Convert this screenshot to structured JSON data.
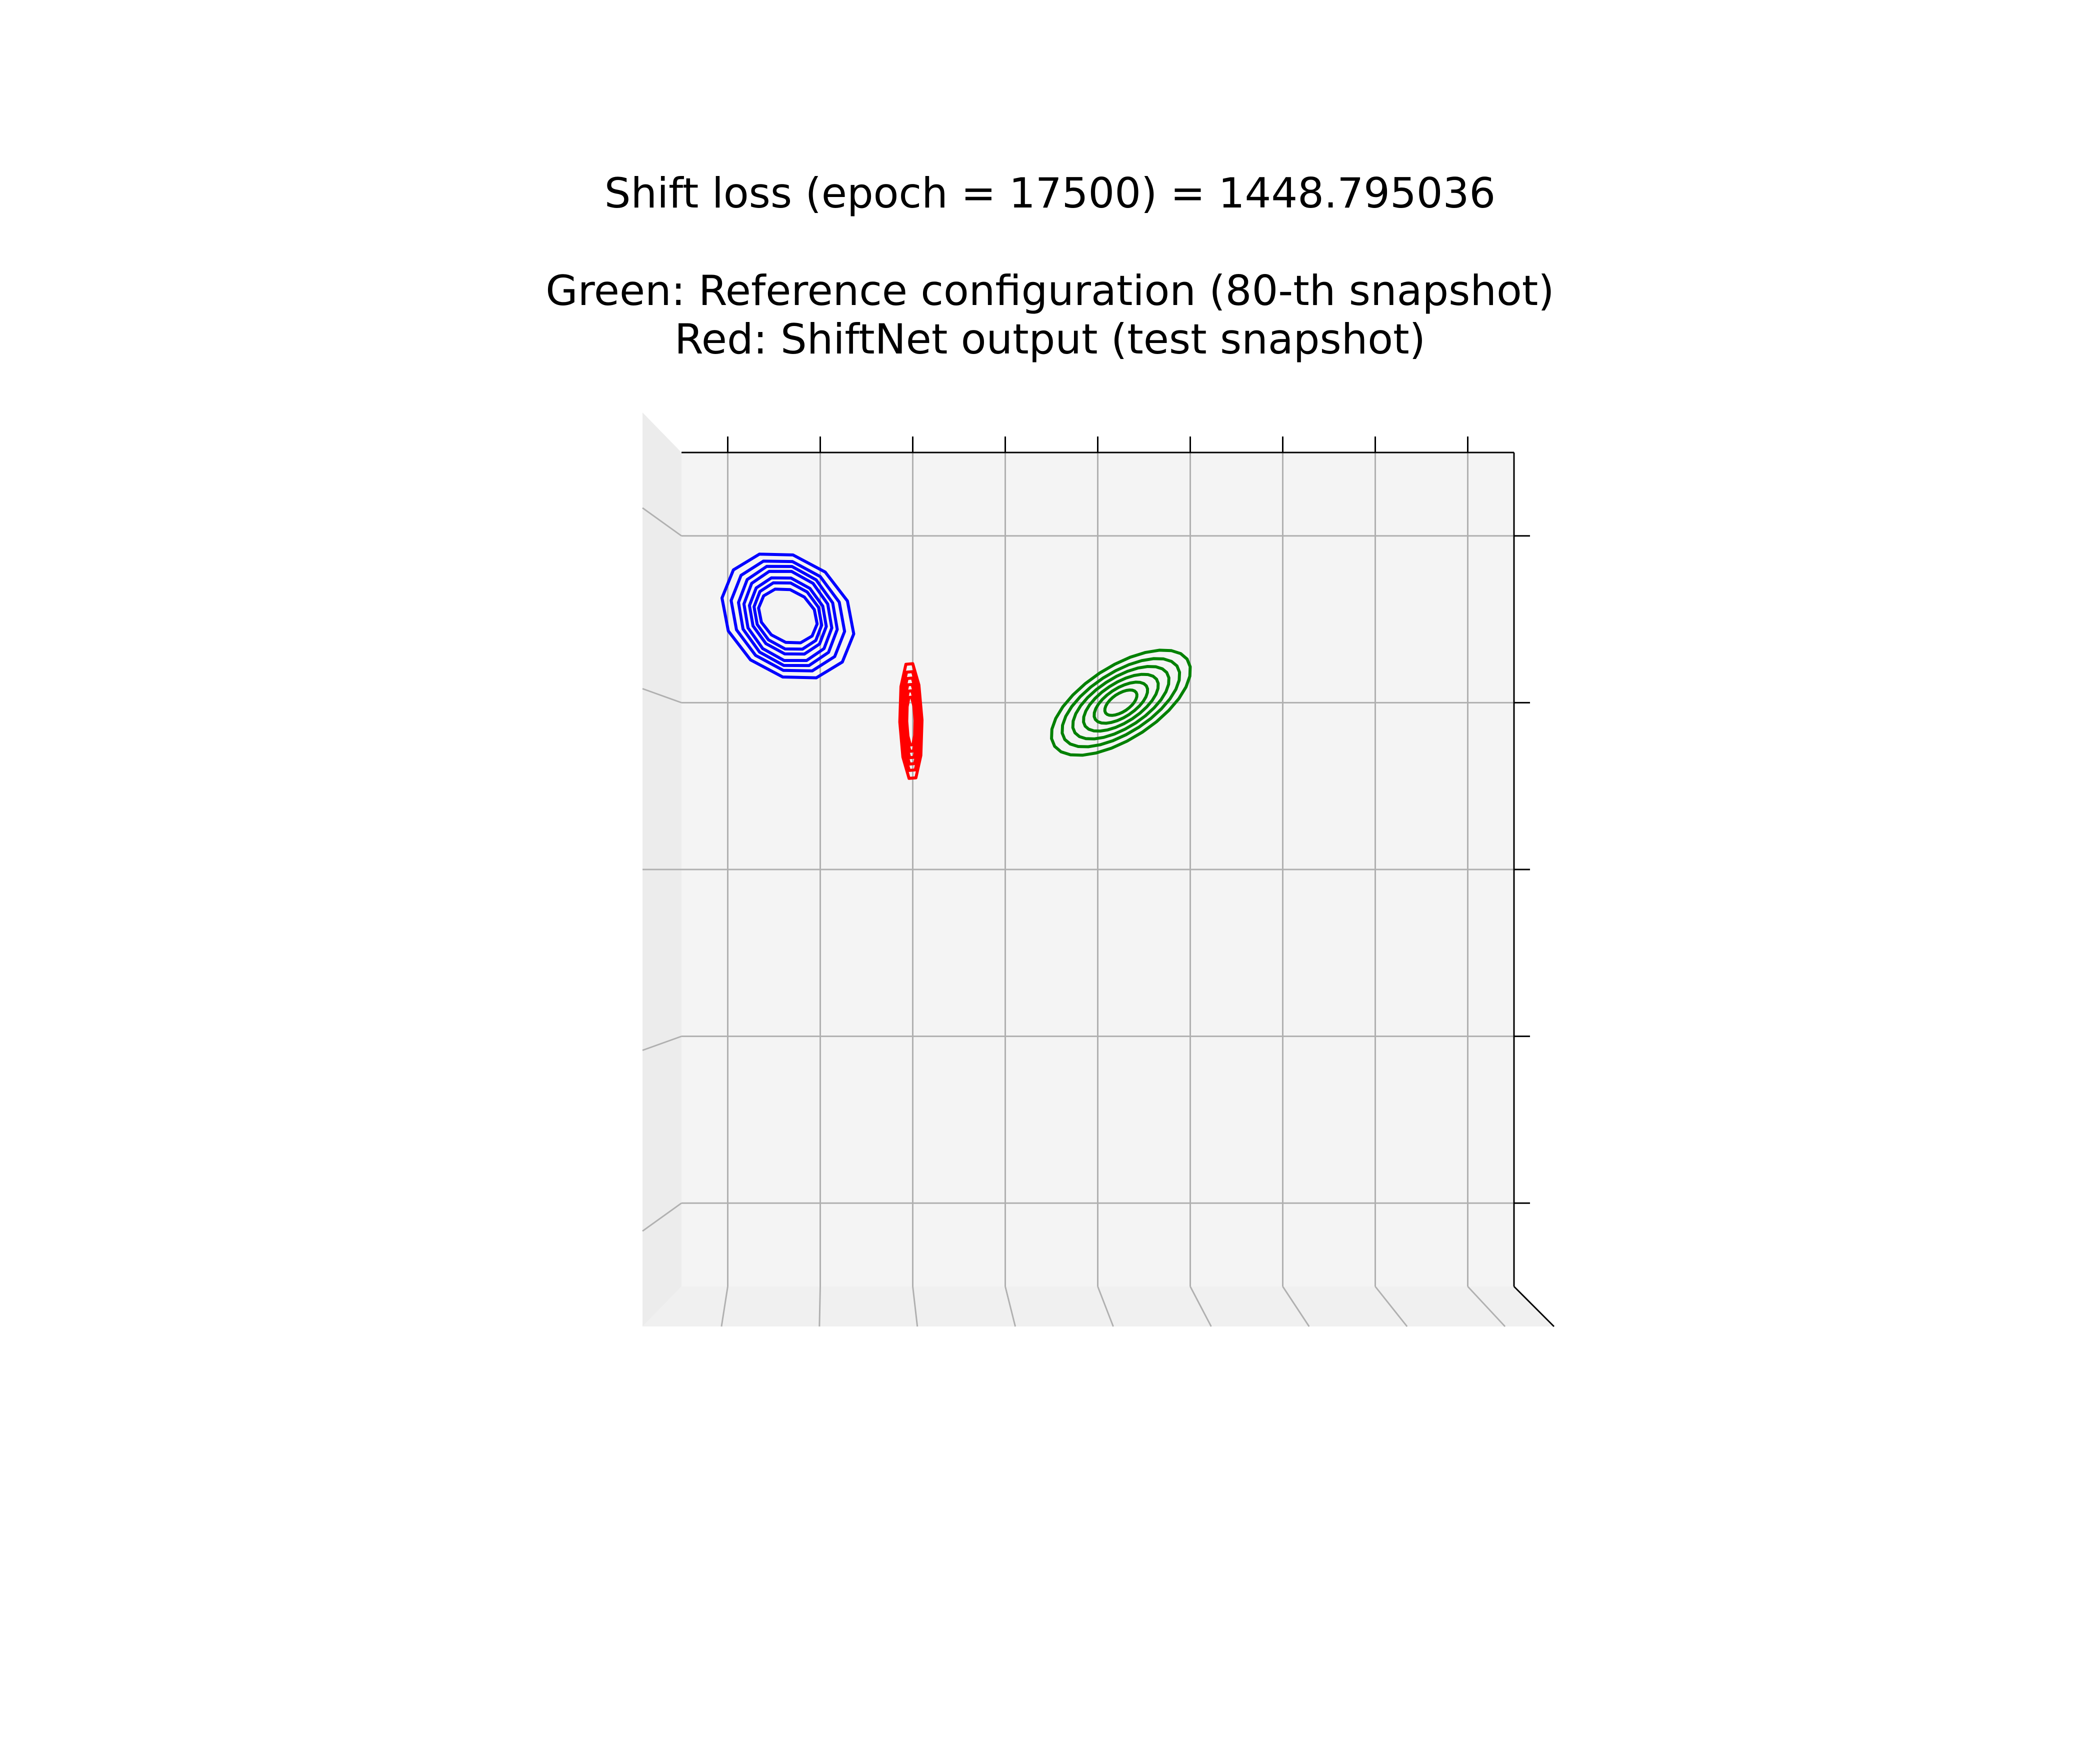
{
  "chart_data": {
    "type": "contour",
    "title_lines": [
      "Shift loss (epoch = 17500) = 1448.795036",
      "",
      "Green: Reference configuration (80-th snapshot)",
      "Red: ShiftNet output (test snapshot)"
    ],
    "xlabel": "",
    "ylabel": "",
    "xlim": [
      0,
      9
    ],
    "ylim": [
      0,
      5
    ],
    "x_ticks": [
      0.5,
      1.5,
      2.5,
      3.5,
      4.5,
      5.5,
      6.5,
      7.5,
      8.5
    ],
    "y_ticks": [
      0.5,
      1.5,
      2.5,
      3.5,
      4.5
    ],
    "tick_labels_shown": false,
    "grid": true,
    "view": "3d-top",
    "pane_color": "#f4f4f4",
    "series": [
      {
        "color": "#0000ff",
        "center": [
          1.15,
          4.02
        ],
        "levels": [
          {
            "radius": [
              0.72,
              0.37
            ],
            "points": 12
          },
          {
            "radius": [
              0.62,
              0.33
            ],
            "points": 12
          },
          {
            "radius": [
              0.54,
              0.3
            ],
            "points": 12
          },
          {
            "radius": [
              0.48,
              0.27
            ],
            "points": 12
          },
          {
            "radius": [
              0.42,
              0.23
            ],
            "points": 12
          },
          {
            "radius": [
              0.37,
              0.2
            ],
            "points": 12
          },
          {
            "radius": [
              0.32,
              0.16
            ],
            "points": 12
          }
        ]
      },
      {
        "color": "#ff0000",
        "center": [
          2.48,
          3.39
        ],
        "levels": [
          {
            "radius": [
              0.12,
              0.36
            ],
            "points": 10
          },
          {
            "radius": [
              0.105,
              0.31
            ],
            "points": 10
          },
          {
            "radius": [
              0.09,
              0.27
            ],
            "points": 10
          },
          {
            "radius": [
              0.075,
              0.23
            ],
            "points": 10
          },
          {
            "radius": [
              0.06,
              0.19
            ],
            "points": 10
          },
          {
            "radius": [
              0.045,
              0.15
            ],
            "points": 10
          }
        ]
      },
      {
        "color": "#008000",
        "center": [
          4.75,
          3.5
        ],
        "levels": [
          {
            "radius": [
              0.78,
              0.24
            ],
            "points": 28
          },
          {
            "radius": [
              0.66,
              0.2
            ],
            "points": 28
          },
          {
            "radius": [
              0.54,
              0.165
            ],
            "points": 28
          },
          {
            "radius": [
              0.42,
              0.13
            ],
            "points": 28
          },
          {
            "radius": [
              0.3,
              0.095
            ],
            "points": 28
          },
          {
            "radius": [
              0.18,
              0.06
            ],
            "points": 28
          }
        ]
      }
    ]
  }
}
